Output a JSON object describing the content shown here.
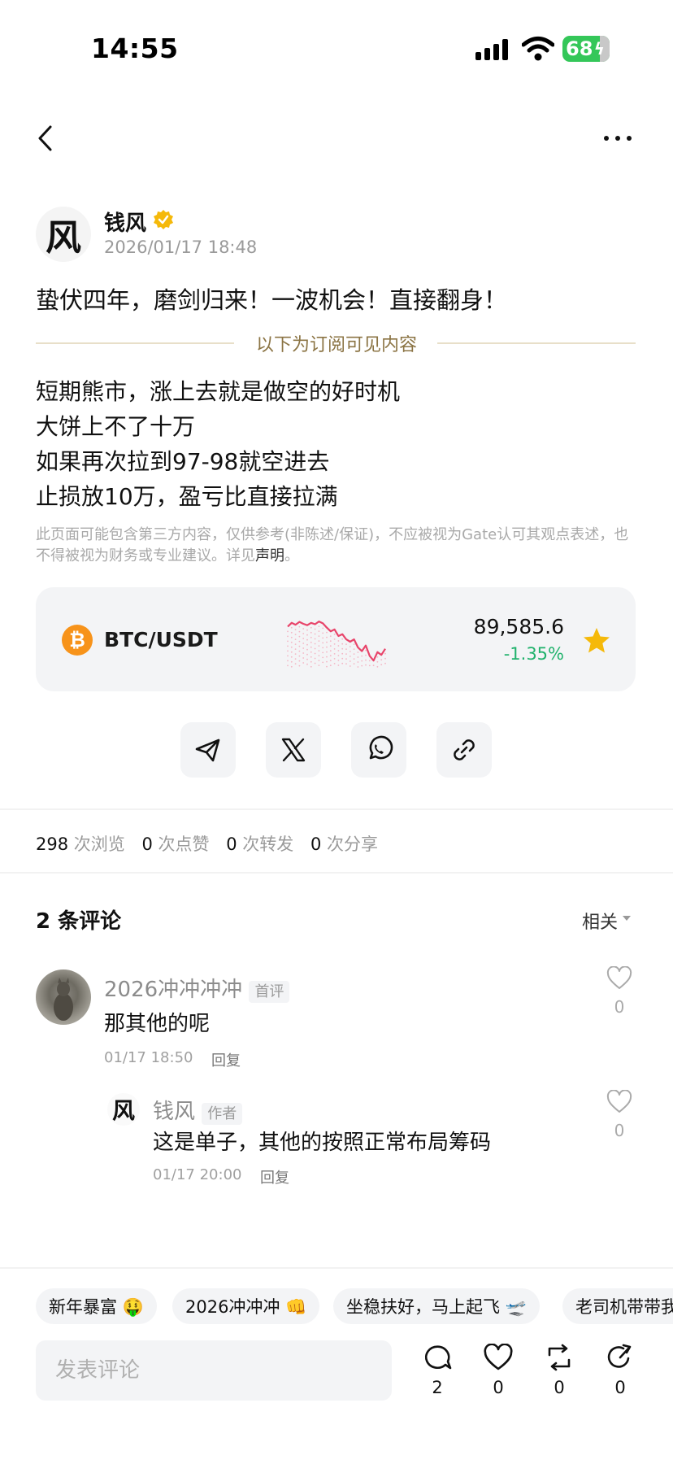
{
  "status_bar": {
    "time": "14:55",
    "battery": "68"
  },
  "author": {
    "avatar_char": "风",
    "name": "钱风",
    "time": "2026/01/17 18:48"
  },
  "post": {
    "title": "蛰伏四年，磨剑归来！一波机会！直接翻身！",
    "subscription_divider": "以下为订阅可见内容",
    "lines": [
      "短期熊市，涨上去就是做空的好时机",
      "大饼上不了十万",
      "如果再次拉到97-98就空进去",
      "止损放10万，盈亏比直接拉满"
    ],
    "disclaimer": "此页面可能包含第三方内容，仅供参考(非陈述/保证)，不应被视为Gate认可其观点表述，也不得被视为财务或专业建议。详见",
    "disclaimer_link": "声明",
    "disclaimer_end": "。"
  },
  "ticker": {
    "icon": "₿",
    "pair": "BTC/USDT",
    "price": "89,585.6",
    "change": "-1.35%",
    "spark": [
      0.82,
      0.9,
      0.86,
      0.92,
      0.88,
      0.85,
      0.9,
      0.87,
      0.93,
      0.89,
      0.8,
      0.72,
      0.76,
      0.62,
      0.66,
      0.55,
      0.5,
      0.55,
      0.38,
      0.3,
      0.42,
      0.2,
      0.1,
      0.28,
      0.22,
      0.35
    ],
    "colors": {
      "down": "#e8446a",
      "up": "#20b26c",
      "btc": "#f7931a",
      "star": "#f5b90a"
    }
  },
  "share_icons": [
    "telegram-icon",
    "x-icon",
    "whatsapp-icon",
    "link-icon"
  ],
  "stats": [
    {
      "value": "298",
      "label": "次浏览"
    },
    {
      "value": "0",
      "label": "次点赞"
    },
    {
      "value": "0",
      "label": "次转发"
    },
    {
      "value": "0",
      "label": "次分享"
    }
  ],
  "comments_header": {
    "title": "2 条评论",
    "sort": "相关"
  },
  "comment": {
    "name": "2026冲冲冲冲",
    "tag": "首评",
    "text": "那其他的呢",
    "time": "01/17 18:50",
    "reply_label": "回复",
    "likes": "0"
  },
  "reply": {
    "avatar_char": "风",
    "name": "钱风",
    "tag": "作者",
    "text": "这是单子，其他的按照正常布局筹码",
    "time": "01/17 20:00",
    "reply_label": "回复",
    "likes": "0"
  },
  "quick_replies": [
    "新年暴富 🤑",
    "2026冲冲冲 👊",
    "坐稳扶好，马上起飞 🛫",
    "老司机带带我"
  ],
  "composer": {
    "placeholder": "发表评论"
  },
  "actions": [
    {
      "icon": "comment-icon",
      "count": "2"
    },
    {
      "icon": "like-icon",
      "count": "0"
    },
    {
      "icon": "repost-icon",
      "count": "0"
    },
    {
      "icon": "share-icon",
      "count": "0"
    }
  ]
}
